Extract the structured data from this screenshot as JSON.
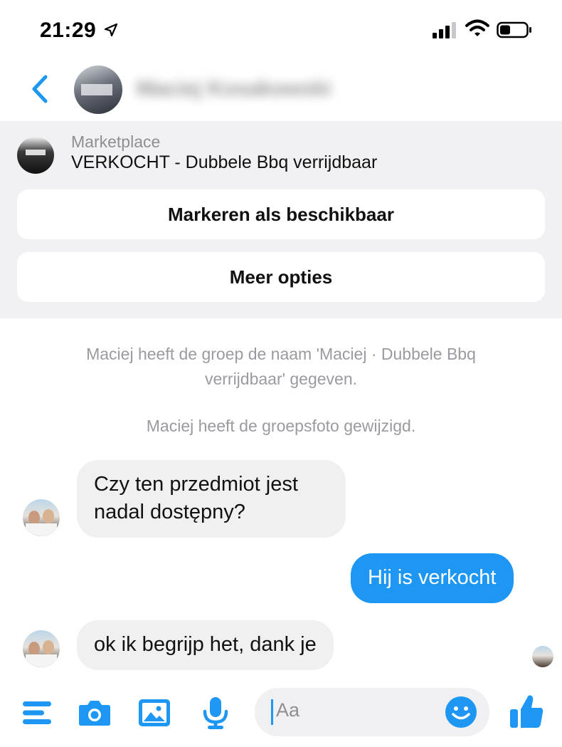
{
  "status_bar": {
    "time": "21:29",
    "icons": [
      "location-arrow-icon",
      "signal-icon",
      "wifi-icon",
      "battery-icon"
    ]
  },
  "header": {
    "back_icon": "chevron-left-icon",
    "contact_name": "Maciej Kosakowski",
    "accent_color": "#1d97f3"
  },
  "marketplace": {
    "label": "Marketplace",
    "title": "VERKOCHT - Dubbele Bbq verrijdbaar",
    "mark_available_label": "Markeren als beschikbaar",
    "more_options_label": "Meer opties"
  },
  "system_messages": [
    {
      "line1": "Maciej heeft de groep de naam 'Maciej · Dubbele Bbq",
      "line2": "verrijdbaar' gegeven."
    },
    {
      "line1": "Maciej heeft de groepsfoto gewijzigd."
    }
  ],
  "messages": [
    {
      "direction": "incoming",
      "text_line1": "Czy ten przedmiot jest",
      "text_line2": "nadal dostępny?"
    },
    {
      "direction": "outgoing",
      "text": "Hij is verkocht"
    },
    {
      "direction": "incoming",
      "text": "ok ik begrijp het, dank je"
    }
  ],
  "composer": {
    "placeholder": "Aa",
    "icons": [
      "menu-icon",
      "camera-icon",
      "gallery-icon",
      "microphone-icon",
      "emoji-icon",
      "thumbs-up-icon"
    ]
  },
  "colors": {
    "accent": "#1d97f3",
    "incoming_bubble": "#f0f0f0",
    "panel_bg": "#f1f1f3"
  }
}
